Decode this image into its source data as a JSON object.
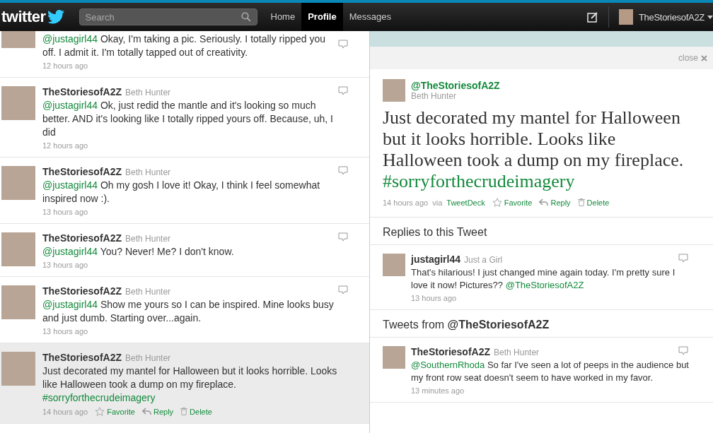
{
  "topbar": {
    "logo": "twitter",
    "search_placeholder": "Search",
    "links": [
      {
        "label": "Home",
        "selected": false
      },
      {
        "label": "Profile",
        "selected": true
      },
      {
        "label": "Messages",
        "selected": false
      }
    ],
    "user": "TheStoriesofA2Z"
  },
  "timeline": [
    {
      "mention": "@justagirl44",
      "text": "Okay, I'm taking a pic. Seriously. I totally ripped you off. I admit it. I'm totally tapped out of creativity.",
      "time": "12 hours ago",
      "selected": false
    },
    {
      "user": "TheStoriesofA2Z",
      "name": "Beth Hunter",
      "mention": "@justagirl44",
      "text": "Ok, just redid the mantle and it's looking so much better. AND it's looking like I totally ripped yours off. Because, uh, I did",
      "time": "12 hours ago",
      "selected": false
    },
    {
      "user": "TheStoriesofA2Z",
      "name": "Beth Hunter",
      "mention": "@justagirl44",
      "text": "Oh my gosh I love it! Okay, I think I feel somewhat inspired now :).",
      "time": "13 hours ago",
      "selected": false
    },
    {
      "user": "TheStoriesofA2Z",
      "name": "Beth Hunter",
      "mention": "@justagirl44",
      "text": "You? Never! Me? I don't know.",
      "time": "13 hours ago",
      "selected": false
    },
    {
      "user": "TheStoriesofA2Z",
      "name": "Beth Hunter",
      "mention": "@justagirl44",
      "text": "Show me yours so I can be inspired. Mine looks busy and just dumb. Starting over...again.",
      "time": "13 hours ago",
      "selected": false
    },
    {
      "user": "TheStoriesofA2Z",
      "name": "Beth Hunter",
      "text": "Just decorated my mantel for Halloween but it looks horrible. Looks like Halloween took a dump on my fireplace.",
      "hashtag": "#sorryforthecrudeimagery",
      "time": "14 hours ago",
      "selected": true,
      "actions": [
        {
          "kind": "favorite",
          "label": "Favorite"
        },
        {
          "kind": "reply",
          "label": "Reply"
        },
        {
          "kind": "delete",
          "label": "Delete"
        }
      ]
    }
  ],
  "details": {
    "close": "close",
    "handle": "@TheStoriesofA2Z",
    "name": "Beth Hunter",
    "text": "Just decorated my mantel for Halloween but it looks horrible. Looks like Halloween took a dump on my fireplace.",
    "hashtag": "#sorryforthecrudeimagery",
    "time": "14 hours ago",
    "via": "via",
    "client": "TweetDeck",
    "actions": [
      {
        "kind": "favorite",
        "label": "Favorite"
      },
      {
        "kind": "reply",
        "label": "Reply"
      },
      {
        "kind": "delete",
        "label": "Delete"
      }
    ]
  },
  "replies_heading": "Replies to this Tweet",
  "replies": [
    {
      "user": "justagirl44",
      "name": "Just a Girl",
      "text": "That's hilarious! I just changed mine again today. I'm pretty sure I love it now! Pictures??",
      "mention_after": "@TheStoriesofA2Z",
      "time": "13 hours ago"
    }
  ],
  "tweets_from": {
    "prefix": "Tweets from",
    "handle": "@TheStoriesofA2Z"
  },
  "tweets": [
    {
      "user": "TheStoriesofA2Z",
      "name": "Beth Hunter",
      "mention": "@SouthernRhoda",
      "text": "So far I've seen a lot of peeps in the audience but my front row seat doesn't seem to have worked in my favor.",
      "time": "13 minutes ago"
    }
  ]
}
